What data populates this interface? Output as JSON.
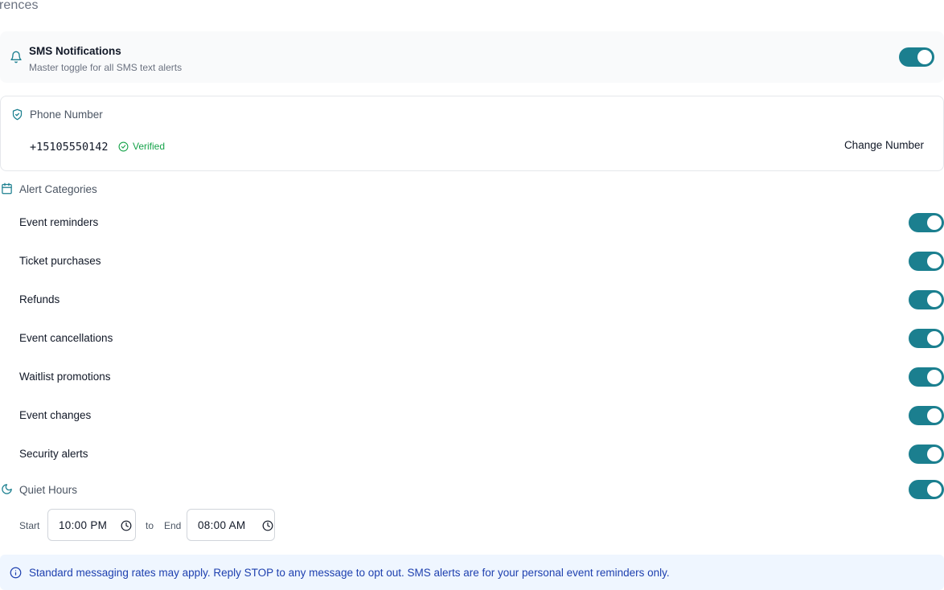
{
  "page": {
    "heading_fragment": "rences"
  },
  "sms": {
    "title": "SMS Notifications",
    "subtitle": "Master toggle for all SMS text alerts",
    "enabled": true,
    "icon": "bell-icon"
  },
  "phone": {
    "heading": "Phone Number",
    "number": "+15105550142",
    "status": "Verified",
    "change_label": "Change Number",
    "icon": "shield-check-icon"
  },
  "alerts": {
    "heading": "Alert Categories",
    "icon": "calendar-icon",
    "items": [
      {
        "label": "Event reminders",
        "enabled": true
      },
      {
        "label": "Ticket purchases",
        "enabled": true
      },
      {
        "label": "Refunds",
        "enabled": true
      },
      {
        "label": "Event cancellations",
        "enabled": true
      },
      {
        "label": "Waitlist promotions",
        "enabled": true
      },
      {
        "label": "Event changes",
        "enabled": true
      },
      {
        "label": "Security alerts",
        "enabled": true
      }
    ]
  },
  "quiet_hours": {
    "heading": "Quiet Hours",
    "icon": "moon-icon",
    "enabled": true,
    "start_label": "Start",
    "start_value": "10:00 PM",
    "separator": "to",
    "end_label": "End",
    "end_value": "08:00 AM"
  },
  "info": {
    "text": "Standard messaging rates may apply. Reply STOP to any message to opt out. SMS alerts are for your personal event reminders only.",
    "icon": "info-icon"
  },
  "colors": {
    "accent": "#1b7f8f",
    "verified": "#16a34a",
    "info_bg": "#eff6ff",
    "info_text": "#1e40af"
  }
}
